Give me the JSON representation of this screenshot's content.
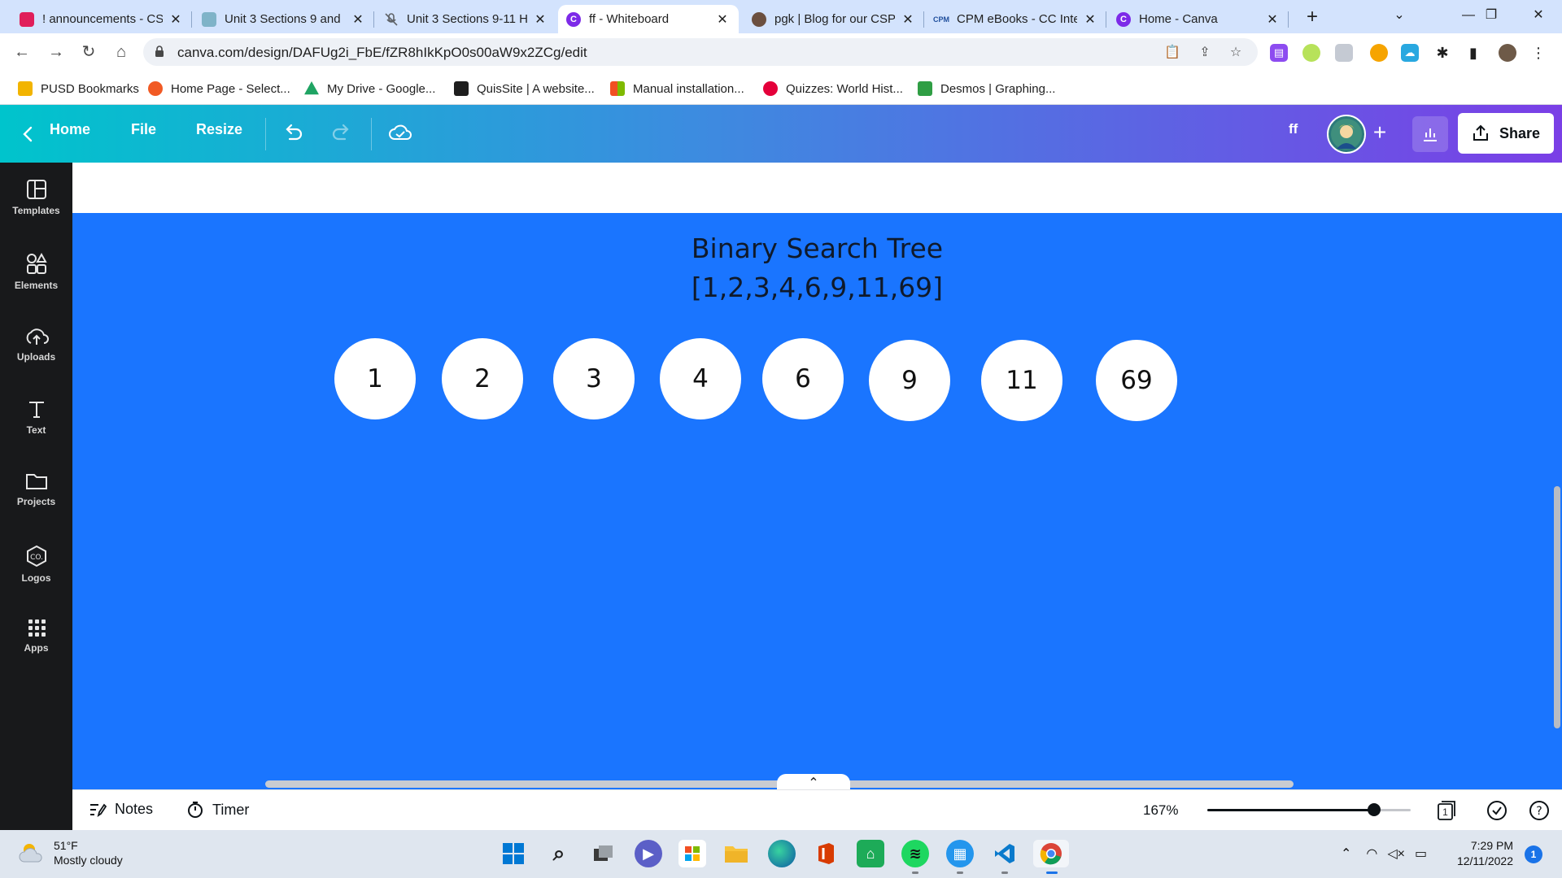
{
  "browser": {
    "tabs": [
      {
        "title": "! announcements - CS",
        "favicon_color": "#e01e5a",
        "favicon_glyph": "",
        "active": false
      },
      {
        "title": "Unit 3 Sections 9 and",
        "favicon_color": "#7fb3c8",
        "favicon_glyph": "",
        "active": false
      },
      {
        "title": "Unit 3 Sections 9-11 H",
        "favicon_color": "#5f6368",
        "favicon_glyph": "",
        "active": false
      },
      {
        "title": "ff - Whiteboard",
        "favicon_color": "#7d2ae8",
        "favicon_glyph": "C",
        "active": true
      },
      {
        "title": "pgk | Blog for our CSP",
        "favicon_color": "#6b4f3f",
        "favicon_glyph": "",
        "active": false
      },
      {
        "title": "CPM eBooks - CC Integ",
        "favicon_color": "#1f4e9c",
        "favicon_glyph": "CPM",
        "active": false
      },
      {
        "title": "Home - Canva",
        "favicon_color": "#7d2ae8",
        "favicon_glyph": "C",
        "active": false
      }
    ],
    "url": "canva.com/design/DAFUg2i_FbE/fZR8hIkKpO0s00aW9x2ZCg/edit",
    "bookmarks": [
      {
        "label": "PUSD Bookmarks",
        "color": "#f2b400"
      },
      {
        "label": "Home Page - Select...",
        "color": "#f15a24"
      },
      {
        "label": "My Drive - Google...",
        "color": "#1fa463"
      },
      {
        "label": "QuisSite | A website...",
        "color": "#1e1e1e"
      },
      {
        "label": "Manual installation...",
        "color": "#00a4ef"
      },
      {
        "label": "Quizzes: World Hist...",
        "color": "#e4003a"
      },
      {
        "label": "Desmos | Graphing...",
        "color": "#2f9e44"
      }
    ]
  },
  "canva": {
    "nav": {
      "home": "Home",
      "file": "File",
      "resize": "Resize"
    },
    "design_name": "ff",
    "share_label": "Share",
    "sidebar": [
      {
        "label": "Templates",
        "icon": "templates-icon"
      },
      {
        "label": "Elements",
        "icon": "elements-icon"
      },
      {
        "label": "Uploads",
        "icon": "uploads-icon"
      },
      {
        "label": "Text",
        "icon": "text-icon"
      },
      {
        "label": "Projects",
        "icon": "projects-icon"
      },
      {
        "label": "Logos",
        "icon": "logos-icon"
      },
      {
        "label": "Apps",
        "icon": "apps-icon"
      }
    ],
    "board": {
      "title_line1": "Binary Search Tree",
      "title_line2": "[1,2,3,4,6,9,11,69]",
      "nodes": [
        "1",
        "2",
        "3",
        "4",
        "6",
        "9",
        "11",
        "69"
      ],
      "background": "#1a75ff"
    },
    "footer": {
      "notes": "Notes",
      "timer": "Timer",
      "zoom": "167%",
      "zoom_level_fraction": 0.82,
      "page_count": "1"
    }
  },
  "taskbar": {
    "weather_temp": "51°F",
    "weather_desc": "Mostly cloudy",
    "time": "7:29 PM",
    "date": "12/11/2022",
    "notifications": "1"
  }
}
